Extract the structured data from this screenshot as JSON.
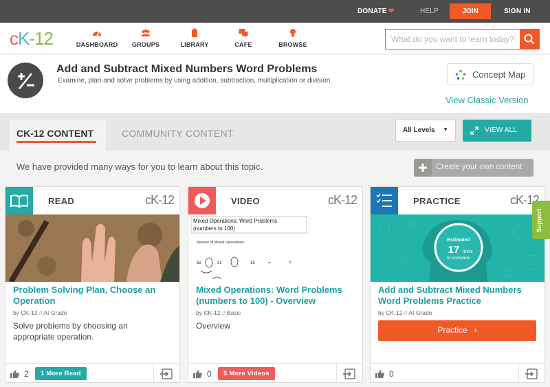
{
  "topbar": {
    "donate": "DONATE",
    "help": "HELP",
    "join": "JOIN",
    "sign_in": "SIGN IN"
  },
  "logo": {
    "c": "c",
    "k": "K",
    "n": "-12"
  },
  "nav": {
    "items": [
      {
        "label": "DASHBOARD",
        "icon": "dashboard-icon"
      },
      {
        "label": "GROUPS",
        "icon": "groups-icon"
      },
      {
        "label": "LIBRARY",
        "icon": "library-icon"
      },
      {
        "label": "CAFE",
        "icon": "cafe-icon"
      },
      {
        "label": "BROWSE",
        "icon": "browse-icon"
      }
    ],
    "search_placeholder": "What do you want to learn today?"
  },
  "header": {
    "title": "Add and Subtract Mixed Numbers Word Problems",
    "subtitle": "Examine, plan and solve problems by using addition, subtraction, multiplication or division.",
    "concept_map": "Concept Map",
    "classic": "View Classic Version"
  },
  "tabs": {
    "active": "CK-12 CONTENT",
    "community": "COMMUNITY CONTENT",
    "levels": "All Levels",
    "view_all": "VIEW ALL"
  },
  "info": {
    "text": "We have provided many ways for you to learn about this topic.",
    "create": "Create your own content"
  },
  "cards": [
    {
      "type": "READ",
      "brand": "cK-12",
      "title": "Problem Solving Plan, Choose an Operation",
      "by": "by CK-12",
      "level": "At Grade",
      "desc": "Solve problems by choosing an appropriate operation.",
      "likes": "2",
      "more": "1 More Read",
      "color": "#26aaa5"
    },
    {
      "type": "VIDEO",
      "brand": "cK-12",
      "title": "Mixed Operations: Word Problems (numbers to 100) - Overview",
      "by": "by CK-12",
      "level": "Basic",
      "desc": "Overview",
      "likes": "0",
      "more": "5 More Videos",
      "color": "#f05a5b",
      "video_thumb": {
        "line1": "Mixed Operations:  Word Problems",
        "line2": "(numbers to 100)",
        "line3": "Review of Mixed Operations:",
        "n1": "62",
        "n2": "31",
        "n3": "15",
        "n4": "=",
        "n5": "?"
      }
    },
    {
      "type": "PRACTICE",
      "brand": "cK-12",
      "title": "Add and Subtract Mixed Numbers Word Problems Practice",
      "by": "by CK-12",
      "level": "At Grade",
      "button": "Practice",
      "likes": "0",
      "color": "#1b78b4",
      "estimate": {
        "label": "Estimated",
        "value": "17",
        "unit": "mins",
        "tail": "to complete"
      }
    }
  ],
  "support": "Support",
  "colors": {
    "accent": "#f05a28",
    "teal": "#26aaa5",
    "green": "#8dbd3f"
  }
}
